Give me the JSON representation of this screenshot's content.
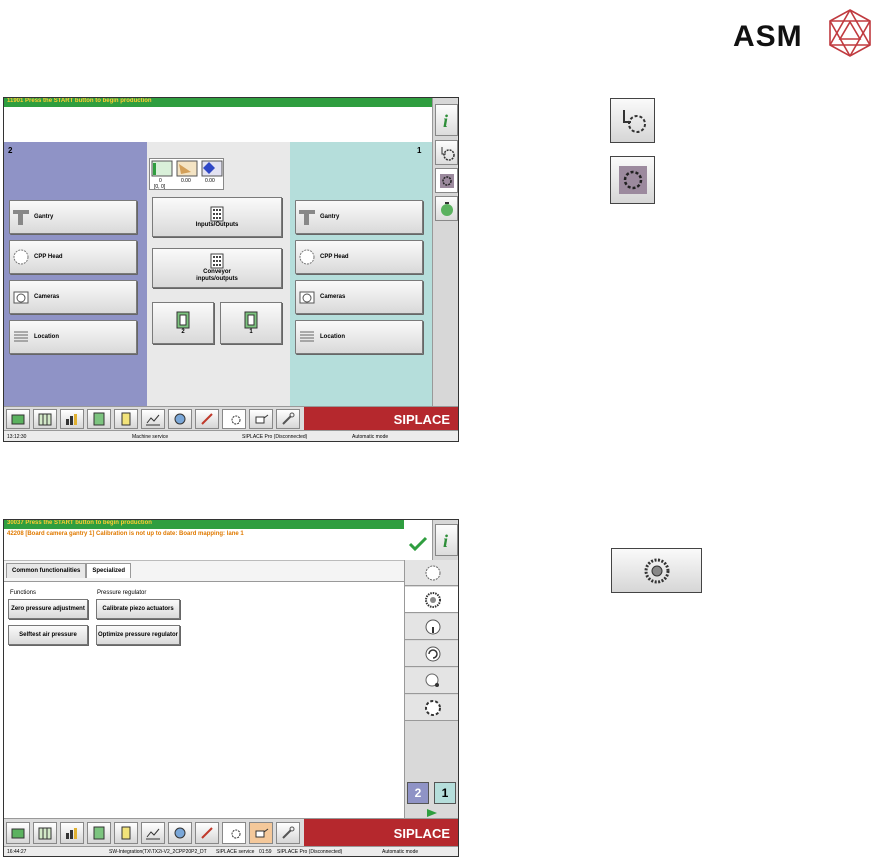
{
  "logo": {
    "text": "ASM"
  },
  "screen1": {
    "top_message": "11901 Press the START button to begin production",
    "left_panel": {
      "number": "2",
      "buttons": [
        "Gantry",
        "CPP Head",
        "Cameras",
        "Location"
      ]
    },
    "right_panel": {
      "number": "1",
      "buttons": [
        "Gantry",
        "CPP Head",
        "Cameras",
        "Location"
      ]
    },
    "center": {
      "mini_values": [
        "0",
        "0.00",
        "0.00"
      ],
      "mini_coord": "[0, 0]",
      "inputs_outputs": "Inputs/Outputs",
      "conveyor_io": "Conveyor inputs/outputs",
      "conveyor_2": "2",
      "conveyor_1": "1"
    },
    "brand": "SIPLACE",
    "status": {
      "time": "13:12:30",
      "service": "Machine service",
      "pro": "SIPLACE Pro (Disconnected)",
      "mode": "Automatic mode"
    }
  },
  "screen2": {
    "top_message": "30037 Press the START button to begin production",
    "warning": "42208 [Board camera gantry 1] Calibration is not up to date: Board mapping: lane 1",
    "tabs": [
      "Common functionalities",
      "Specialized"
    ],
    "functions_label": "Functions",
    "pressure_label": "Pressure regulator",
    "buttons": {
      "zero_pressure": "Zero pressure adjustment",
      "selftest": "Selftest air pressure",
      "calibrate_piezo": "Calibrate piezo actuators",
      "optimize_pressure": "Optimize pressure regulator"
    },
    "gantry_2": "2",
    "gantry_1": "1",
    "brand": "SIPLACE",
    "status": {
      "time": "16:44:27",
      "integration": "SW-Integration(TX\\TX2i-V2_2CPP20P2_DT",
      "service": "SIPLACE service",
      "time2": "01:59",
      "pro": "SIPLACE Pro (Disconnected)",
      "mode": "Automatic mode"
    }
  },
  "colors": {
    "top_bar": "#2f9e3f",
    "left_panel": "#8f93c6",
    "right_panel": "#b5dedb",
    "siplace": "#b5282d",
    "warning_text": "#e07a00"
  }
}
